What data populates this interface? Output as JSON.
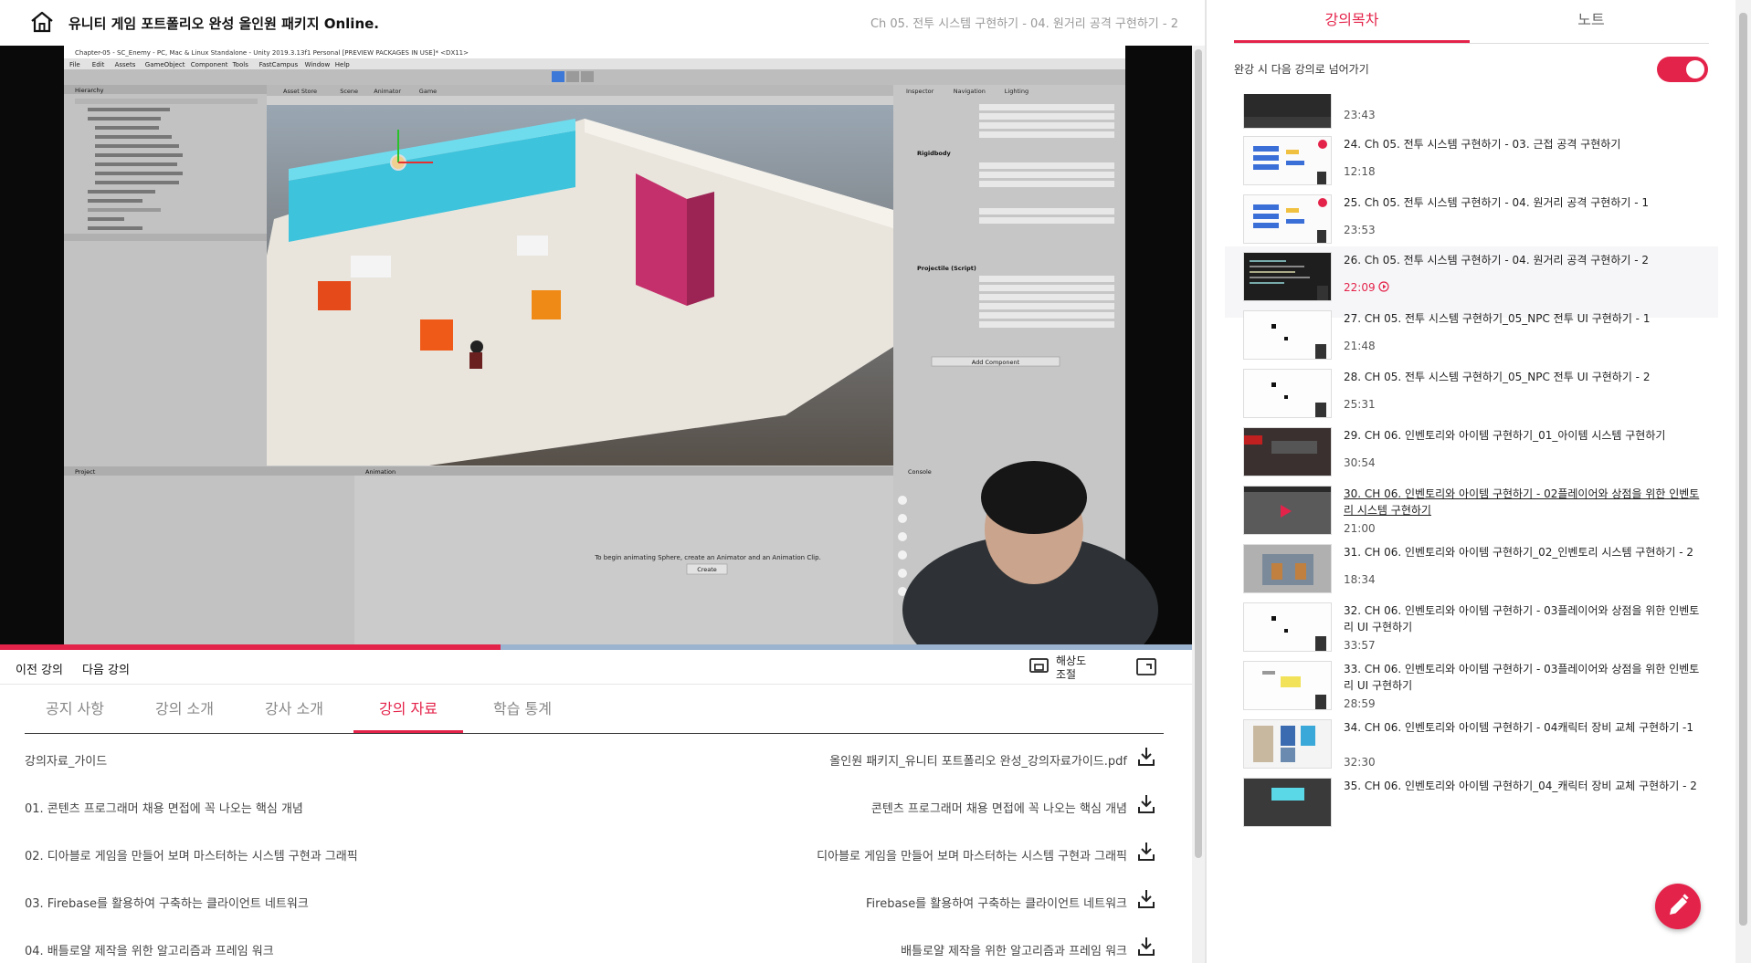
{
  "header": {
    "course_title": "유니티 게임 포트폴리오 완성 올인원 패키지 Online.",
    "current_lecture": "Ch 05. 전투 시스템 구현하기 - 04. 원거리 공격 구현하기 - 2"
  },
  "player": {
    "progress_fraction": 0.42,
    "prev_label": "이전 강의",
    "next_label": "다음 강의",
    "resolution_label": "해상도 조절",
    "video_text": {
      "window_title": "Chapter-05 - SC_Enemy - PC, Mac & Linux Standalone - Unity 2019.3.13f1 Personal [PREVIEW PACKAGES IN USE]* <DX11>",
      "menu": [
        "File",
        "Edit",
        "Assets",
        "GameObject",
        "Component",
        "Tools",
        "FastCampus",
        "Window",
        "Help"
      ],
      "hierarchy_label": "Hierarchy",
      "scene_tabs": [
        "Asset Store",
        "Scene",
        "Animator",
        "Game"
      ],
      "inspector_tabs": [
        "Inspector",
        "Navigation",
        "Lighting"
      ],
      "rigidbody_label": "Rigidbody",
      "projectile_label": "Projectile (Script)",
      "project_label": "Project",
      "animation_label": "Animation",
      "animation_hint": "To begin animating Sphere, create an Animator and an Animation Clip.",
      "create_label": "Create",
      "add_component_label": "Add Component",
      "console_label": "Console"
    }
  },
  "tabs": [
    "공지 사항",
    "강의 소개",
    "강사 소개",
    "강의 자료",
    "학습 통계"
  ],
  "active_tab": "강의 자료",
  "materials": [
    {
      "left": "강의자료_가이드",
      "right": "올인원 패키지_유니티 포트폴리오 완성_강의자료가이드.pdf"
    },
    {
      "left": "01. 콘텐츠 프로그래머 채용 면접에 꼭 나오는 핵심 개념",
      "right": "콘텐츠 프로그래머 채용 면접에 꼭 나오는 핵심 개념"
    },
    {
      "left": "02. 디아블로 게임을 만들어 보며 마스터하는 시스템 구현과 그래픽",
      "right": "디아블로 게임을 만들어 보며 마스터하는 시스템 구현과 그래픽"
    },
    {
      "left": "03. Firebase를 활용하여 구축하는 클라이언트 네트워크",
      "right": "Firebase를 활용하여 구축하는 클라이언트 네트워크"
    },
    {
      "left": "04. 배틀로얄 제작을 위한 알고리즘과 프레임 워크",
      "right": "배틀로얄 제작을 위한 알고리즘과 프레임 워크"
    }
  ],
  "sidebar": {
    "tabs": [
      "강의목차",
      "노트"
    ],
    "autoplay_label": "완강 시 다음 강의로 넘어가기",
    "autoplay_on": true,
    "lectures": [
      {
        "title": "",
        "duration": "23:43",
        "thumb": "dark"
      },
      {
        "title": "24. Ch 05. 전투 시스템 구현하기 - 03. 근접 공격 구현하기",
        "duration": "12:18",
        "thumb": "blue-diagram"
      },
      {
        "title": "25. Ch 05. 전투 시스템 구현하기 - 04. 원거리 공격 구현하기 - 1",
        "duration": "23:53",
        "thumb": "blue-diagram"
      },
      {
        "title": "26. Ch 05. 전투 시스템 구현하기 - 04. 원거리 공격 구현하기 - 2",
        "duration": "22:09",
        "thumb": "code",
        "current": true
      },
      {
        "title": "27. CH 05. 전투 시스템 구현하기_05_NPC 전투 UI 구현하기 - 1",
        "duration": "21:48",
        "thumb": "white"
      },
      {
        "title": "28. CH 05. 전투 시스템 구현하기_05_NPC 전투 UI 구현하기 - 2",
        "duration": "25:31",
        "thumb": "white"
      },
      {
        "title": "29. CH 06. 인벤토리와 아이템 구현하기_01_아이템 시스템 구현하기",
        "duration": "30:54",
        "thumb": "red-dark"
      },
      {
        "title": "30. CH 06. 인벤토리와 아이템 구현하기 - 02플레이어와 상점을 위한 인벤토리 시스템 구현하기",
        "duration": "21:00",
        "thumb": "grey-play",
        "underlined": true
      },
      {
        "title": "31. CH 06. 인벤토리와 아이템 구현하기_02_인벤토리 시스템 구현하기 - 2",
        "duration": "18:34",
        "thumb": "unity"
      },
      {
        "title": "32. CH 06. 인벤토리와 아이템 구현하기 - 03플레이어와 상점을 위한 인벤토리 UI 구현하기",
        "duration": "33:57",
        "thumb": "white"
      },
      {
        "title": "33. CH 06. 인벤토리와 아이템 구현하기 - 03플레이어와 상점을 위한 인벤토리 UI 구현하기",
        "duration": "28:59",
        "thumb": "white-yellow"
      },
      {
        "title": "34. CH 06. 인벤토리와 아이템 구현하기 - 04캐릭터 장비 교체 구현하기 -1",
        "duration": "32:30",
        "thumb": "characters"
      },
      {
        "title": "35. CH 06. 인벤토리와 아이템 구현하기_04_캐릭터 장비 교체 구현하기 - 2",
        "duration": "",
        "thumb": "dark-cyan"
      }
    ]
  },
  "colors": {
    "accent": "#e4234a"
  }
}
